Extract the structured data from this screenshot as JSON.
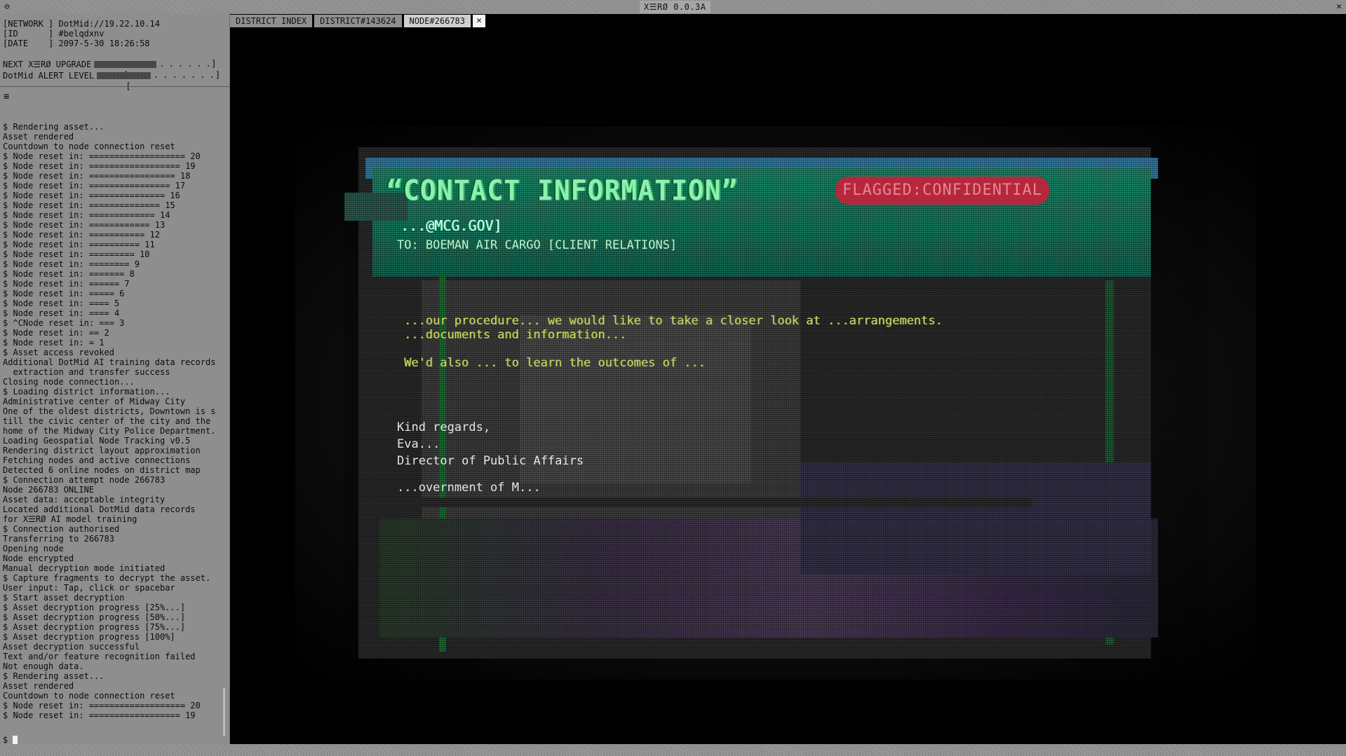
{
  "window": {
    "title": "X☰RØ 0.0.3A",
    "menu_icon": "gear-icon",
    "close_glyph": "✕"
  },
  "info": {
    "network_label": "[NETWORK ]",
    "network_value": "DotMid://19.22.10.14",
    "id_label": "[ID      ]",
    "id_value": "#belqdxnv",
    "date_label": "[DATE    ]",
    "date_value": "2097-5-30 18:26:58"
  },
  "meters": {
    "upgrade_label": "NEXT X☰RØ UPGRADE",
    "upgrade_level": 0.55,
    "alert_label": "DotMid ALERT LEVEL",
    "alert_level": 0.47
  },
  "colors": {
    "panel_bg": "#8e8e8e",
    "tab_active": "#cfcfcf",
    "asset_header": "#2d7fa8",
    "asset_band": "#1f8a5c",
    "flag_red": "#c8203c"
  },
  "log": [
    "$ Rendering asset...",
    "Asset rendered",
    "Countdown to node connection reset",
    "$ Node reset in: =================== 20",
    "$ Node reset in: ================== 19",
    "$ Node reset in: ================= 18",
    "$ Node reset in: ================ 17",
    "$ Node reset in: =============== 16",
    "$ Node reset in: ============== 15",
    "$ Node reset in: ============= 14",
    "$ Node reset in: ============ 13",
    "$ Node reset in: =========== 12",
    "$ Node reset in: ========== 11",
    "$ Node reset in: ========= 10",
    "$ Node reset in: ======== 9",
    "$ Node reset in: ======= 8",
    "$ Node reset in: ====== 7",
    "$ Node reset in: ===== 6",
    "$ Node reset in: ==== 5",
    "$ Node reset in: ==== 4",
    "$ ^CNode reset in: === 3",
    "$ Node reset in: == 2",
    "$ Node reset in: = 1",
    "$ Asset access revoked",
    "Additional DotMid AI training data records",
    "  extraction and transfer success",
    "Closing node connection...",
    "$ Loading district information...",
    "Administrative center of Midway City",
    "One of the oldest districts, Downtown is s",
    "till the civic center of the city and the",
    "home of the Midway City Police Department.",
    "Loading Geospatial Node Tracking v0.5",
    "Rendering district layout approximation",
    "Fetching nodes and active connections",
    "Detected 6 online nodes on district map",
    "$ Connection attempt node 266783",
    "Node 266783 ONLINE",
    "Asset data: acceptable integrity",
    "Located additional DotMid data records",
    "for X☰RØ AI model training",
    "$ Connection authorised",
    "Transferring to 266783",
    "Opening node",
    "Node encrypted",
    "Manual decryption mode initiated",
    "$ Capture fragments to decrypt the asset.",
    "User input: Tap, click or spacebar",
    "$ Start asset decryption",
    "$ Asset decryption progress [25%...]",
    "$ Asset decryption progress [50%...]",
    "$ Asset decryption progress [75%...]",
    "$ Asset decryption progress [100%]",
    "Asset decryption successful",
    "Text and/or feature recognition failed",
    "Not enough data.",
    "$ Rendering asset...",
    "Asset rendered",
    "Countdown to node connection reset",
    "$ Node reset in: =================== 20",
    "$ Node reset in: ================== 19"
  ],
  "prompt": "$ ",
  "tabs": [
    {
      "label": "DISTRICT INDEX"
    },
    {
      "label": "DISTRICT#143624"
    },
    {
      "label": "NODE#266783"
    }
  ],
  "tab_close_glyph": "✕",
  "asset": {
    "title": "“CONTACT INFORMATION”",
    "flag": "FLAGGED:CONFIDENTIAL",
    "email": "...@MCG.GOV]",
    "to": "TO: BOEMAN AIR CARGO [CLIENT RELATIONS]",
    "body": [
      "...our procedure... we would like to take a closer look at ...arrangements.",
      "...documents and information...",
      "We'd also ... to learn the outcomes of ..."
    ],
    "signature": [
      "Kind regards,",
      "Eva...",
      "Director of Public Affairs",
      "...overnment of M..."
    ]
  }
}
